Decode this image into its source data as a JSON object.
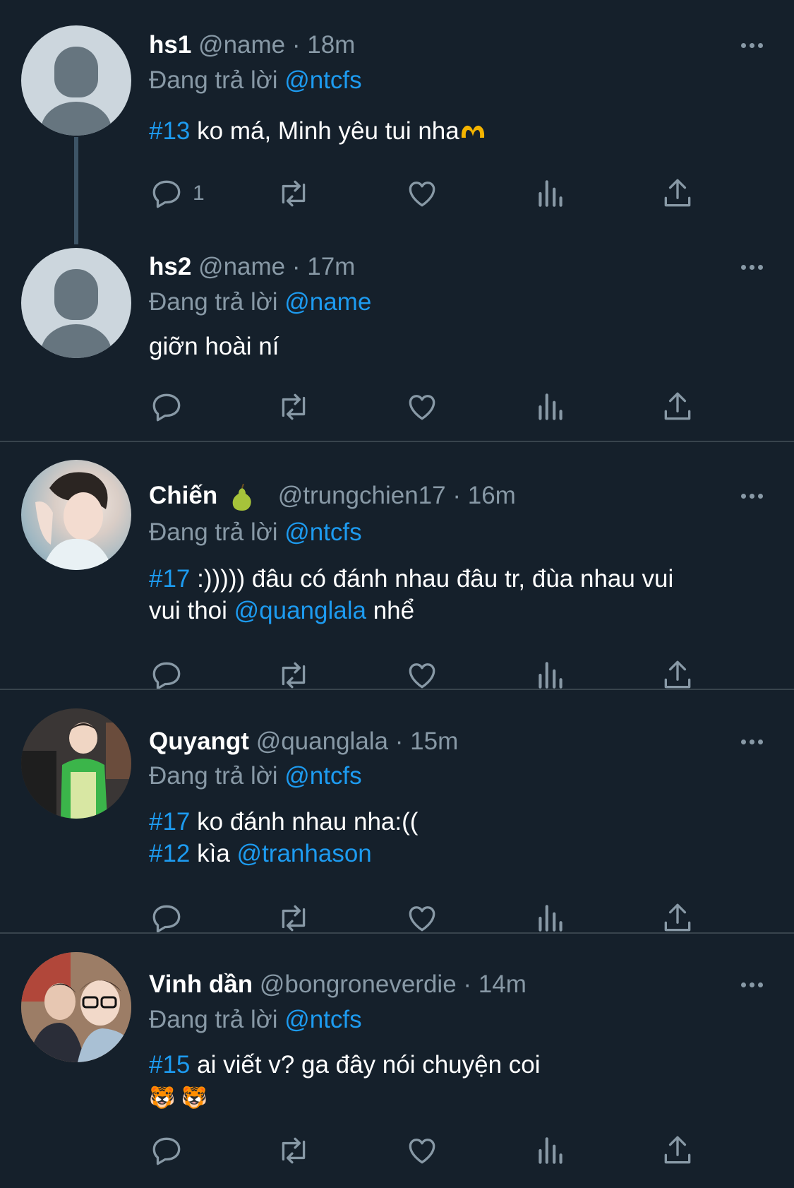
{
  "tweets": [
    {
      "name": "hs1",
      "handle": "@name",
      "time": "· 18m",
      "replying_prefix": "Đang trả lời",
      "replying_to": "@ntcfs",
      "tag": "#13",
      "text": " ko má, Minh yêu tui nha",
      "reply_count": "1"
    },
    {
      "name": "hs2",
      "handle": "@name",
      "time": "· 17m",
      "replying_prefix": "Đang trả lời",
      "replying_to": "@name",
      "text": "giỡn hoài ní"
    },
    {
      "name": "Chiến",
      "handle": "@trungchien17",
      "time": "· 16m",
      "replying_prefix": "Đang trả lời",
      "replying_to": "@ntcfs",
      "tag": "#17",
      "text1": " :))))) đâu có đánh nhau đâu tr, đùa nhau vui",
      "text2": "vui thoi ",
      "mention": "@quanglala",
      "text3": " nhể"
    },
    {
      "name": "Quyangt",
      "handle": "@quanglala",
      "time": "· 15m",
      "replying_prefix": "Đang trả lời",
      "replying_to": "@ntcfs",
      "tag1": "#17",
      "text1": " ko đánh nhau nha:((",
      "tag2": "#12",
      "text2": " kìa ",
      "mention": "@tranhason"
    },
    {
      "name": "Vinh dần",
      "handle": "@bongroneverdie",
      "time": "· 14m",
      "replying_prefix": "Đang trả lời",
      "replying_to": "@ntcfs",
      "tag": "#15",
      "text": " ai viết v? ga đây nói chuyện coi",
      "emojis": "🐯 🐯"
    }
  ],
  "icons": {
    "reply": "reply-icon",
    "retweet": "retweet-icon",
    "like": "heart-icon",
    "views": "analytics-icon",
    "share": "share-icon",
    "more": "more-icon"
  },
  "colors": {
    "background": "#15202b",
    "accent": "#1d9bf0",
    "muted": "#8899a6",
    "divider": "#38444d"
  }
}
